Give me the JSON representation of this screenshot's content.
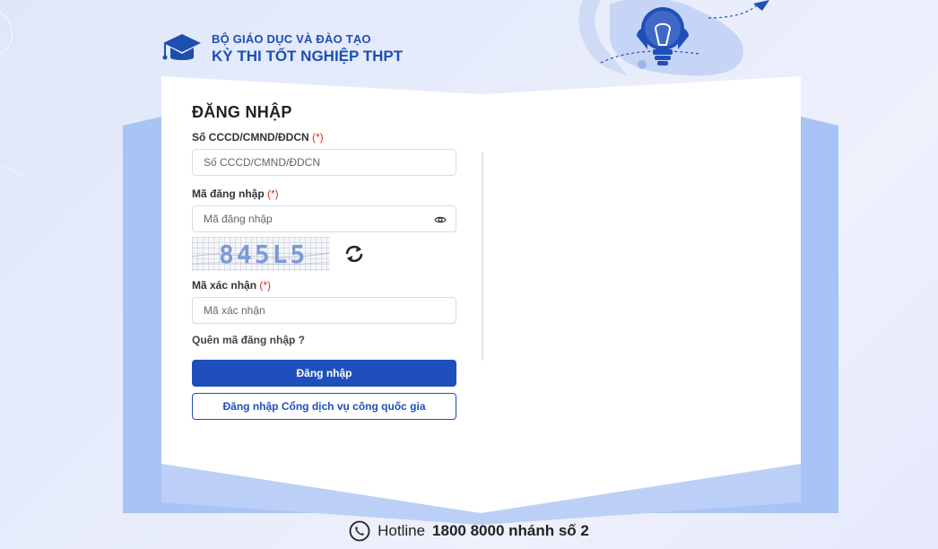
{
  "header": {
    "line1": "BỘ GIÁO DỤC VÀ ĐÀO TẠO",
    "line2": "KỲ THI TỐT NGHIỆP THPT"
  },
  "form": {
    "title": "ĐĂNG NHẬP",
    "id_label": "Số CCCD/CMND/ĐDCN",
    "id_placeholder": "Số CCCD/CMND/ĐDCN",
    "login_code_label": "Mã đăng nhập",
    "login_code_placeholder": "Mã đăng nhập",
    "captcha_text": "845L5",
    "verify_label": "Mã xác nhận",
    "verify_placeholder": "Mã xác nhận",
    "required_mark": "(*)",
    "forgot_link": "Quên mã đăng nhập ?",
    "login_button": "Đăng nhập",
    "national_portal_button": "Đăng nhập Cổng dịch vụ công quốc gia"
  },
  "footer": {
    "hotline_label": "Hotline",
    "hotline_number": "1800 8000 nhánh số 2"
  },
  "colors": {
    "brand": "#1c4fb0",
    "primary_button": "#1f4fbb",
    "required": "#e02424",
    "book_blue": "#a8c3f5"
  }
}
